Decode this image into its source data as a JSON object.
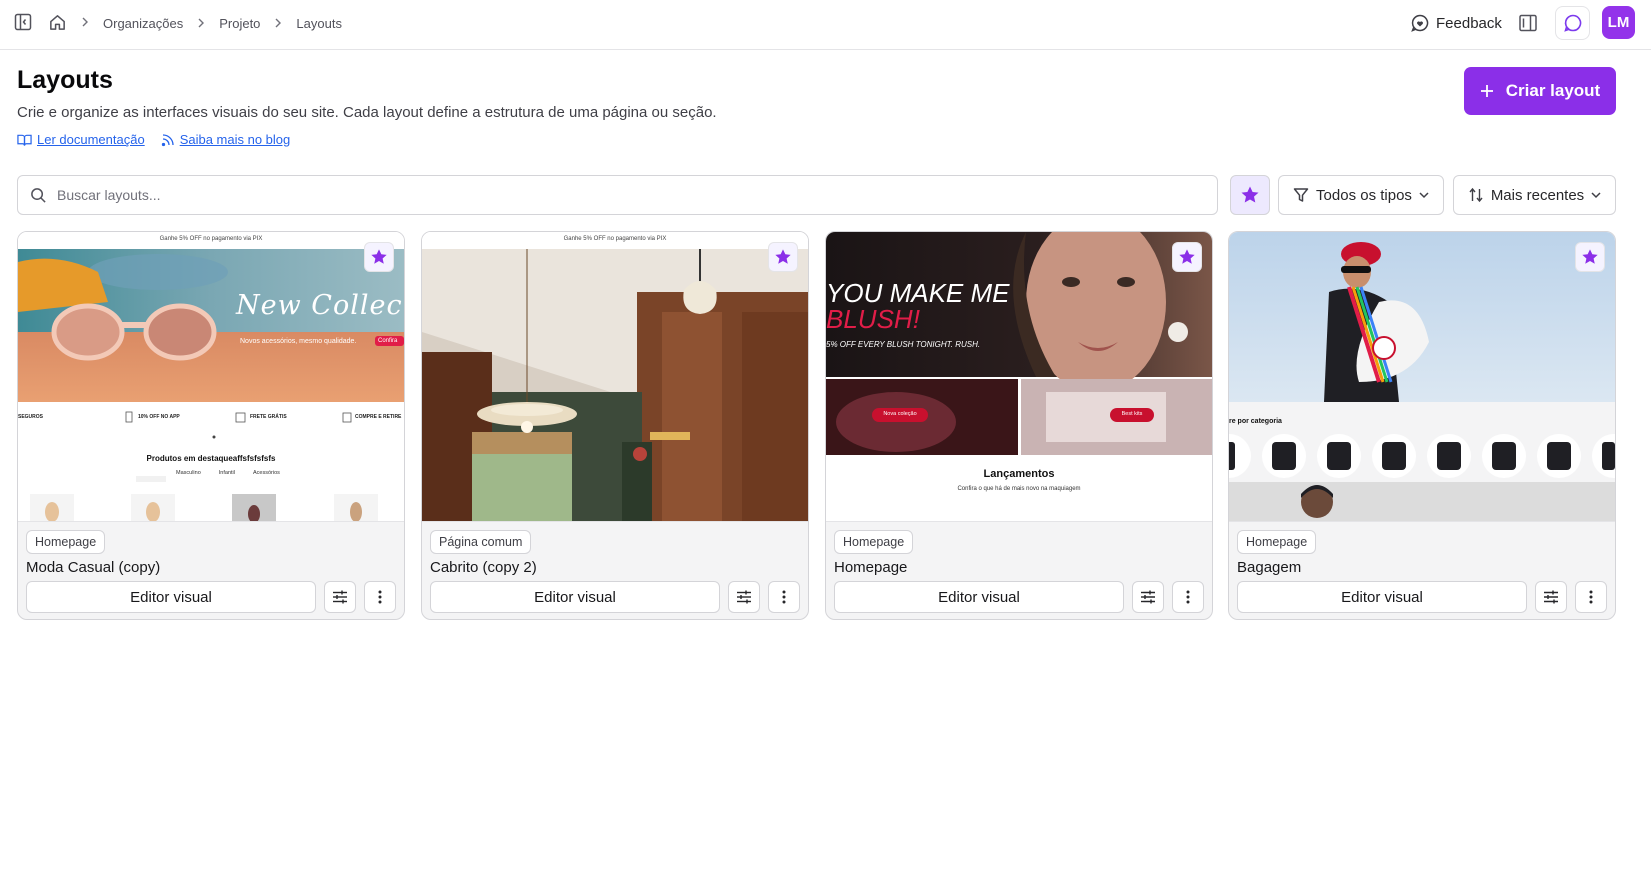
{
  "topbar": {
    "breadcrumbs": [
      "Organizações",
      "Projeto",
      "Layouts"
    ],
    "feedback_label": "Feedback",
    "avatar_initials": "LM"
  },
  "header": {
    "title": "Layouts",
    "description": "Crie e organize as interfaces visuais do seu site. Cada layout define a estrutura de uma página ou seção.",
    "doc_link": "Ler documentação",
    "blog_link": "Saiba mais no blog",
    "create_button": "Criar layout"
  },
  "filters": {
    "search_placeholder": "Buscar layouts...",
    "type_filter": "Todos os tipos",
    "sort": "Mais recentes"
  },
  "cards": [
    {
      "tag": "Homepage",
      "title": "Moda Casual (copy)",
      "editor_label": "Editor visual",
      "thumb": {
        "promo": "Ganhe 5% OFF no pagamento via PIX",
        "hero": "New Collection",
        "sub": "Novos acessórios, mesmo qualidade.",
        "cta": "Confira",
        "benefits": [
          "SEGUROS",
          "10% OFF NO APP",
          "FRETE GRÁTIS",
          "COMPRE E RETIRE"
        ],
        "section": "Produtos em destaqueaffsfsfsfsfs",
        "tabs": [
          "Masculino",
          "Infantil",
          "Acessórios"
        ]
      }
    },
    {
      "tag": "Página comum",
      "title": "Cabrito (copy 2)",
      "editor_label": "Editor visual",
      "thumb": {
        "promo": "Ganhe 5% OFF no pagamento via PIX"
      }
    },
    {
      "tag": "Homepage",
      "title": "Homepage",
      "editor_label": "Editor visual",
      "thumb": {
        "hero1": "YOU MAKE ME",
        "hero2": "BLUSH!",
        "sub": "5% OFF EVERY BLUSH TONIGHT. RUSH.",
        "btn1": "Nova coleção",
        "btn2": "Best kits",
        "section": "Lançamentos",
        "section_sub": "Confira o que há de mais novo na maquiagem"
      }
    },
    {
      "tag": "Homepage",
      "title": "Bagagem",
      "editor_label": "Editor visual",
      "thumb": {
        "section": "re por categoria"
      }
    }
  ],
  "colors": {
    "accent": "#8b2fe8",
    "link": "#2563eb"
  }
}
